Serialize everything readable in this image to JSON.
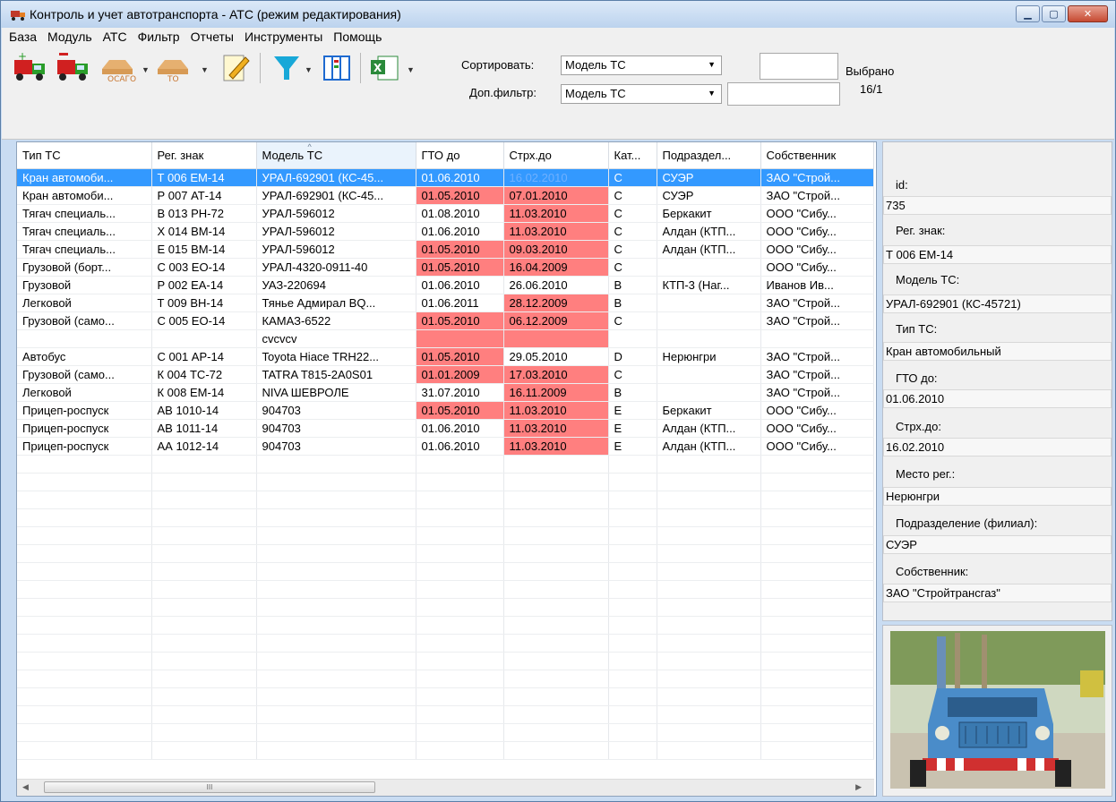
{
  "window": {
    "title": "Контроль и учет автотранспорта - АТС  (режим редактирования)"
  },
  "menu": [
    "База",
    "Модуль",
    "АТС",
    "Фильтр",
    "Отчеты",
    "Инструменты",
    "Помощь"
  ],
  "toolbar": {
    "osago_label": "ОСАГО",
    "to_label": "ТО",
    "sort_label": "Сортировать:",
    "sort_value": "Модель ТС",
    "filter_label": "Доп.фильтр:",
    "filter_value": "Модель ТС",
    "selected_label": "Выбрано",
    "selected_count": "16/1"
  },
  "grid": {
    "columns": [
      "Тип ТС",
      "Рег. знак",
      "Модель ТС",
      "ГТО до",
      "Стрх.до",
      "Кат...",
      "Подраздел...",
      "Собственник"
    ],
    "rows": [
      {
        "type": "Кран автомоби...",
        "reg": "Т 006 ЕМ-14",
        "model": "УРАЛ-692901 (КС-45...",
        "gto": "01.06.2010",
        "strh": "16.02.2010",
        "cat": "С",
        "dept": "СУЭР",
        "owner": "ЗАО \"Строй...",
        "gto_red": false,
        "strh_red": true,
        "selected": true
      },
      {
        "type": "Кран автомоби...",
        "reg": "Р 007 АТ-14",
        "model": "УРАЛ-692901 (КС-45...",
        "gto": "01.05.2010",
        "strh": "07.01.2010",
        "cat": "С",
        "dept": "СУЭР",
        "owner": "ЗАО \"Строй...",
        "gto_red": true,
        "strh_red": true,
        "selected": false
      },
      {
        "type": "Тягач специаль...",
        "reg": "В 013 РН-72",
        "model": "УРАЛ-596012",
        "gto": "01.08.2010",
        "strh": "11.03.2010",
        "cat": "С",
        "dept": "Беркакит",
        "owner": "ООО \"Сибу...",
        "gto_red": false,
        "strh_red": true,
        "selected": false
      },
      {
        "type": "Тягач специаль...",
        "reg": "Х 014 ВМ-14",
        "model": "УРАЛ-596012",
        "gto": "01.06.2010",
        "strh": "11.03.2010",
        "cat": "С",
        "dept": "Алдан (КТП...",
        "owner": "ООО \"Сибу...",
        "gto_red": false,
        "strh_red": true,
        "selected": false
      },
      {
        "type": "Тягач специаль...",
        "reg": "Е 015 ВМ-14",
        "model": "УРАЛ-596012",
        "gto": "01.05.2010",
        "strh": "09.03.2010",
        "cat": "С",
        "dept": "Алдан (КТП...",
        "owner": "ООО \"Сибу...",
        "gto_red": true,
        "strh_red": true,
        "selected": false
      },
      {
        "type": "Грузовой (борт...",
        "reg": "С 003 ЕО-14",
        "model": "УРАЛ-4320-0911-40",
        "gto": "01.05.2010",
        "strh": "16.04.2009",
        "cat": "С",
        "dept": "",
        "owner": "ООО \"Сибу...",
        "gto_red": true,
        "strh_red": true,
        "selected": false
      },
      {
        "type": "Грузовой",
        "reg": "Р 002 ЕА-14",
        "model": "УАЗ-220694",
        "gto": "01.06.2010",
        "strh": "26.06.2010",
        "cat": "В",
        "dept": "КТП-3 (Наг...",
        "owner": "Иванов Ив...",
        "gto_red": false,
        "strh_red": false,
        "selected": false
      },
      {
        "type": "Легковой",
        "reg": "Т 009 ВН-14",
        "model": "Тянье Адмирал BQ...",
        "gto": "01.06.2011",
        "strh": "28.12.2009",
        "cat": "В",
        "dept": "",
        "owner": "ЗАО \"Строй...",
        "gto_red": false,
        "strh_red": true,
        "selected": false
      },
      {
        "type": "Грузовой (само...",
        "reg": "С 005 ЕО-14",
        "model": "КАМАЗ-6522",
        "gto": "01.05.2010",
        "strh": "06.12.2009",
        "cat": "С",
        "dept": "",
        "owner": "ЗАО \"Строй...",
        "gto_red": true,
        "strh_red": true,
        "selected": false
      },
      {
        "type": "",
        "reg": "",
        "model": "cvcvcv",
        "gto": "",
        "strh": "",
        "cat": "",
        "dept": "",
        "owner": "",
        "gto_red": true,
        "strh_red": true,
        "selected": false
      },
      {
        "type": "Автобус",
        "reg": "С 001 АР-14",
        "model": "Toyota Hiace TRH22...",
        "gto": "01.05.2010",
        "strh": "29.05.2010",
        "cat": "D",
        "dept": "Нерюнгри",
        "owner": "ЗАО \"Строй...",
        "gto_red": true,
        "strh_red": false,
        "selected": false
      },
      {
        "type": "Грузовой (само...",
        "reg": "К 004 ТС-72",
        "model": "TATRA T815-2A0S01",
        "gto": "01.01.2009",
        "strh": "17.03.2010",
        "cat": "С",
        "dept": "",
        "owner": "ЗАО \"Строй...",
        "gto_red": true,
        "strh_red": true,
        "selected": false
      },
      {
        "type": "Легковой",
        "reg": "К 008 ЕМ-14",
        "model": "NIVA ШЕВРОЛЕ",
        "gto": "31.07.2010",
        "strh": "16.11.2009",
        "cat": "В",
        "dept": "",
        "owner": "ЗАО \"Строй...",
        "gto_red": false,
        "strh_red": true,
        "selected": false
      },
      {
        "type": "Прицеп-роспуск",
        "reg": "АВ 1010-14",
        "model": "904703",
        "gto": "01.05.2010",
        "strh": "11.03.2010",
        "cat": "Е",
        "dept": "Беркакит",
        "owner": "ООО \"Сибу...",
        "gto_red": true,
        "strh_red": true,
        "selected": false
      },
      {
        "type": "Прицеп-роспуск",
        "reg": "АВ 1011-14",
        "model": "904703",
        "gto": "01.06.2010",
        "strh": "11.03.2010",
        "cat": "Е",
        "dept": "Алдан (КТП...",
        "owner": "ООО \"Сибу...",
        "gto_red": false,
        "strh_red": true,
        "selected": false
      },
      {
        "type": "Прицеп-роспуск",
        "reg": "АА 1012-14",
        "model": "904703",
        "gto": "01.06.2010",
        "strh": "11.03.2010",
        "cat": "Е",
        "dept": "Алдан (КТП...",
        "owner": "ООО \"Сибу...",
        "gto_red": false,
        "strh_red": true,
        "selected": false
      }
    ],
    "empty_rows": 17
  },
  "details": {
    "id_label": "id:",
    "id_value": "735",
    "reg_label": "Рег. знак:",
    "reg_value": "Т 006 ЕМ-14",
    "model_label": "Модель ТС:",
    "model_value": "УРАЛ-692901 (КС-45721)",
    "type_label": "Тип ТС:",
    "type_value": "Кран автомобильный",
    "gto_label": "ГТО до:",
    "gto_value": "01.06.2010",
    "strh_label": "Стрх.до:",
    "strh_value": "16.02.2010",
    "place_label": "Место рег.:",
    "place_value": "Нерюнгри",
    "dept_label": "Подразделение (филиал):",
    "dept_value": "СУЭР",
    "owner_label": "Собственник:",
    "owner_value": "ЗАО \"Стройтрансгаз\""
  },
  "scrollbar": {
    "thumb_grip": "III"
  },
  "colors": {
    "selection": "#3399ff",
    "expired": "#ff7f7f",
    "chrome": "#f0f0f0"
  }
}
